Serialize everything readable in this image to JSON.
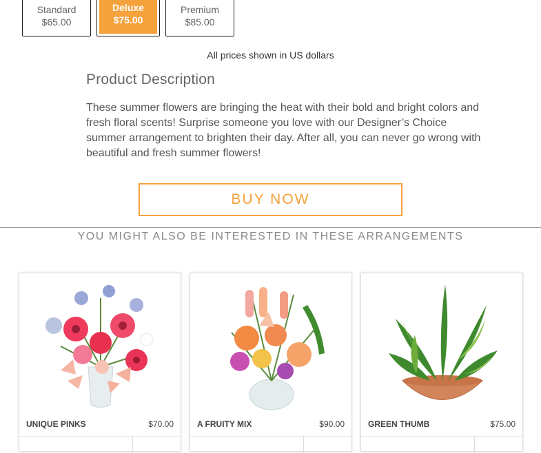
{
  "tiers": [
    {
      "name": "Standard",
      "price": "$65.00"
    },
    {
      "name": "Deluxe",
      "price": "$75.00"
    },
    {
      "name": "Premium",
      "price": "$85.00"
    }
  ],
  "price_note": "All prices shown in US dollars",
  "description": {
    "heading": "Product Description",
    "body": "These summer flowers are bringing the heat with their bold and bright colors and fresh floral scents! Surprise someone you love with our Designer’s Choice summer arrangement to brighten their day. After all, you can never go wrong with beautiful and fresh summer flowers!"
  },
  "buy_label": "BUY NOW",
  "also_heading": "YOU MIGHT ALSO BE INTERESTED IN THESE ARRANGEMENTS",
  "products": [
    {
      "name": "UNIQUE PINKS",
      "price": "$70.00"
    },
    {
      "name": "A FRUITY MIX",
      "price": "$90.00"
    },
    {
      "name": "GREEN THUMB",
      "price": "$75.00"
    }
  ],
  "colors": {
    "accent": "#f5a13c"
  }
}
